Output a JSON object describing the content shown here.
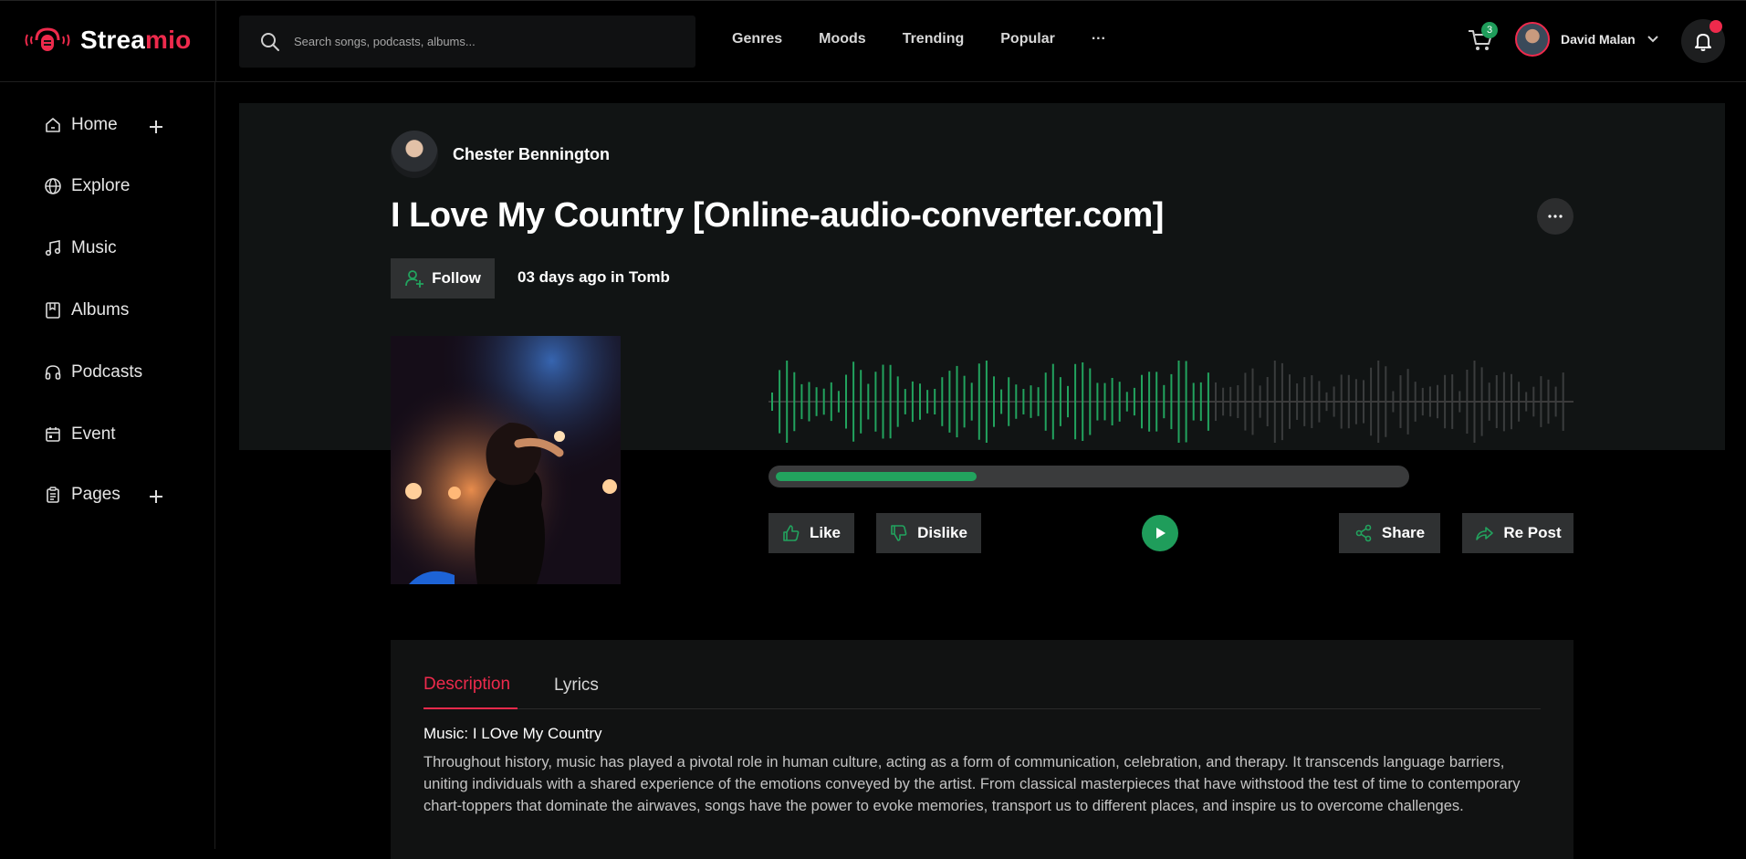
{
  "header": {
    "brand_part1": "Strea",
    "brand_part2": "mio",
    "search_placeholder": "Search songs, podcasts, albums...",
    "nav": [
      "Genres",
      "Moods",
      "Trending",
      "Popular",
      "···"
    ],
    "cart_count": "3",
    "user_name": "David Malan"
  },
  "sidebar": {
    "items": [
      {
        "label": "Home",
        "icon": "home-icon"
      },
      {
        "label": "Explore",
        "icon": "globe-icon"
      },
      {
        "label": "Music",
        "icon": "music-note-icon"
      },
      {
        "label": "Albums",
        "icon": "album-icon"
      },
      {
        "label": "Podcasts",
        "icon": "headphones-icon"
      },
      {
        "label": "Event",
        "icon": "calendar-icon"
      },
      {
        "label": "Pages",
        "icon": "clipboard-icon"
      }
    ]
  },
  "track": {
    "artist": "Chester Bennington",
    "title": "I Love My Country [Online-audio-converter.com]",
    "follow_label": "Follow",
    "posted": "03 days ago in Tomb",
    "progress_fraction": 0.32,
    "like_label": "Like",
    "dislike_label": "Dislike",
    "share_label": "Share",
    "repost_label": "Re Post"
  },
  "details": {
    "tabs": [
      "Description",
      "Lyrics"
    ],
    "music_line": "Music: I LOve My Country",
    "description": "Throughout history, music has played a pivotal role in human culture, acting as a form of communication, celebration, and therapy. It transcends language barriers, uniting individuals with a shared experience of the emotions conveyed by the artist. From classical masterpieces that have withstood the test of time to contemporary chart-toppers that dominate the airwaves, songs have the power to evoke memories, transport us to different places, and inspire us to overcome challenges."
  },
  "colors": {
    "accent": "#ee2a4c",
    "green": "#1f9d5b",
    "background": "#000000",
    "panel": "#111414"
  }
}
